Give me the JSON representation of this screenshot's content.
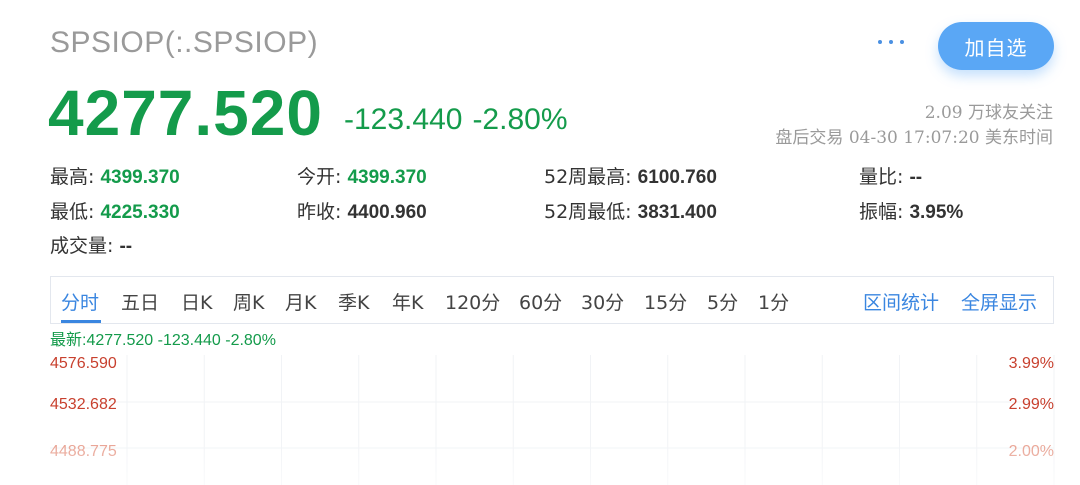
{
  "header": {
    "title": "SPSIOP(:.SPSIOP)",
    "more_icon": "more-dots-icon",
    "add_button": "加自选"
  },
  "quote": {
    "price": "4277.520",
    "change": "-123.440",
    "change_pct": "-2.80%",
    "followers": "2.09 万球友关注",
    "after_hours": "盘后交易 04-30 17:07:20 美东时间"
  },
  "stats": {
    "high_label": "最高:",
    "high": "4399.370",
    "open_label": "今开:",
    "open": "4399.370",
    "w52_high_label": "52周最高:",
    "w52_high": "6100.760",
    "vol_ratio_label": "量比:",
    "vol_ratio": "--",
    "low_label": "最低:",
    "low": "4225.330",
    "prev_close_label": "昨收:",
    "prev_close": "4400.960",
    "w52_low_label": "52周最低:",
    "w52_low": "3831.400",
    "amplitude_label": "振幅:",
    "amplitude": "3.95%",
    "volume_label": "成交量:",
    "volume": "--"
  },
  "tabs": {
    "items": [
      "分时",
      "五日",
      "日K",
      "周K",
      "月K",
      "季K",
      "年K",
      "120分",
      "60分",
      "30分",
      "15分",
      "5分",
      "1分"
    ],
    "active": "分时",
    "stats_link": "区间统计",
    "fullscreen_link": "全屏显示"
  },
  "latest": {
    "text": "最新:4277.520 -123.440 -2.80%"
  },
  "chart_data": {
    "type": "line",
    "y_left_ticks": [
      "4576.590",
      "4532.682",
      "4488.775"
    ],
    "y_right_ticks": [
      "3.99%",
      "2.99%",
      "2.00%"
    ],
    "series": []
  },
  "colors": {
    "down_green": "#149b4b",
    "up_red": "#d0402b",
    "accent_blue": "#3a86e0",
    "button_blue": "#5aa7f5"
  }
}
